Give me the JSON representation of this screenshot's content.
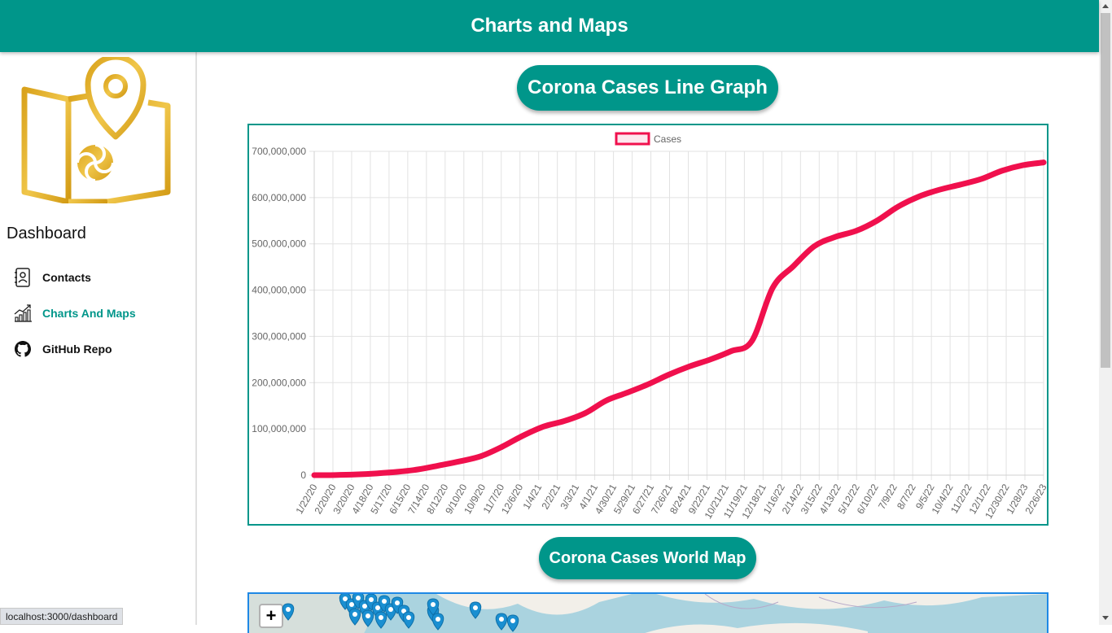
{
  "header": {
    "title": "Charts and Maps"
  },
  "sidebar": {
    "title": "Dashboard",
    "items": [
      {
        "label": "Contacts",
        "icon": "contacts-icon",
        "active": false
      },
      {
        "label": "Charts And Maps",
        "icon": "chart-line-icon",
        "active": true
      },
      {
        "label": "GitHub Repo",
        "icon": "github-icon",
        "active": false
      }
    ]
  },
  "main": {
    "line_graph_title": "Corona Cases Line Graph",
    "map_title": "Corona Cases World Map",
    "map_zoom_in": "+"
  },
  "status_bar": {
    "url": "localhost:3000/dashboard"
  },
  "colors": {
    "accent": "#00968a",
    "line": "#f0104d",
    "map_border": "#1e88e5",
    "map_water": "#aad3df"
  },
  "chart_data": {
    "type": "line",
    "legend": "top",
    "series": [
      {
        "name": "Cases",
        "values": [
          0,
          300000,
          1500000,
          3800000,
          7200000,
          12500000,
          21000000,
          30000000,
          41000000,
          61000000,
          85000000,
          105000000,
          117000000,
          134000000,
          161000000,
          178000000,
          196000000,
          217000000,
          235000000,
          250000000,
          268000000,
          290000000,
          405000000,
          452000000,
          495000000,
          515000000,
          528000000,
          550000000,
          580000000,
          602000000,
          617000000,
          628000000,
          640000000,
          658000000,
          670000000,
          676000000
        ]
      }
    ],
    "x_labels": [
      "1/22/20",
      "2/20/20",
      "3/20/20",
      "4/18/20",
      "5/17/20",
      "6/15/20",
      "7/14/20",
      "8/12/20",
      "9/10/20",
      "10/9/20",
      "11/7/20",
      "12/6/20",
      "1/4/21",
      "2/2/21",
      "3/3/21",
      "4/1/21",
      "4/30/21",
      "5/29/21",
      "6/27/21",
      "7/26/21",
      "8/24/21",
      "9/22/21",
      "10/21/21",
      "11/19/21",
      "12/18/21",
      "1/16/22",
      "2/14/22",
      "3/15/22",
      "4/13/22",
      "5/12/22",
      "6/10/22",
      "7/9/22",
      "8/7/22",
      "9/5/22",
      "10/4/22",
      "11/2/22",
      "12/1/22",
      "12/30/22",
      "1/28/23",
      "2/26/23"
    ],
    "y_ticks": [
      "0",
      "100,000,000",
      "200,000,000",
      "300,000,000",
      "400,000,000",
      "500,000,000",
      "600,000,000",
      "700,000,000"
    ],
    "ylim": [
      0,
      700000000
    ],
    "grid": true
  }
}
